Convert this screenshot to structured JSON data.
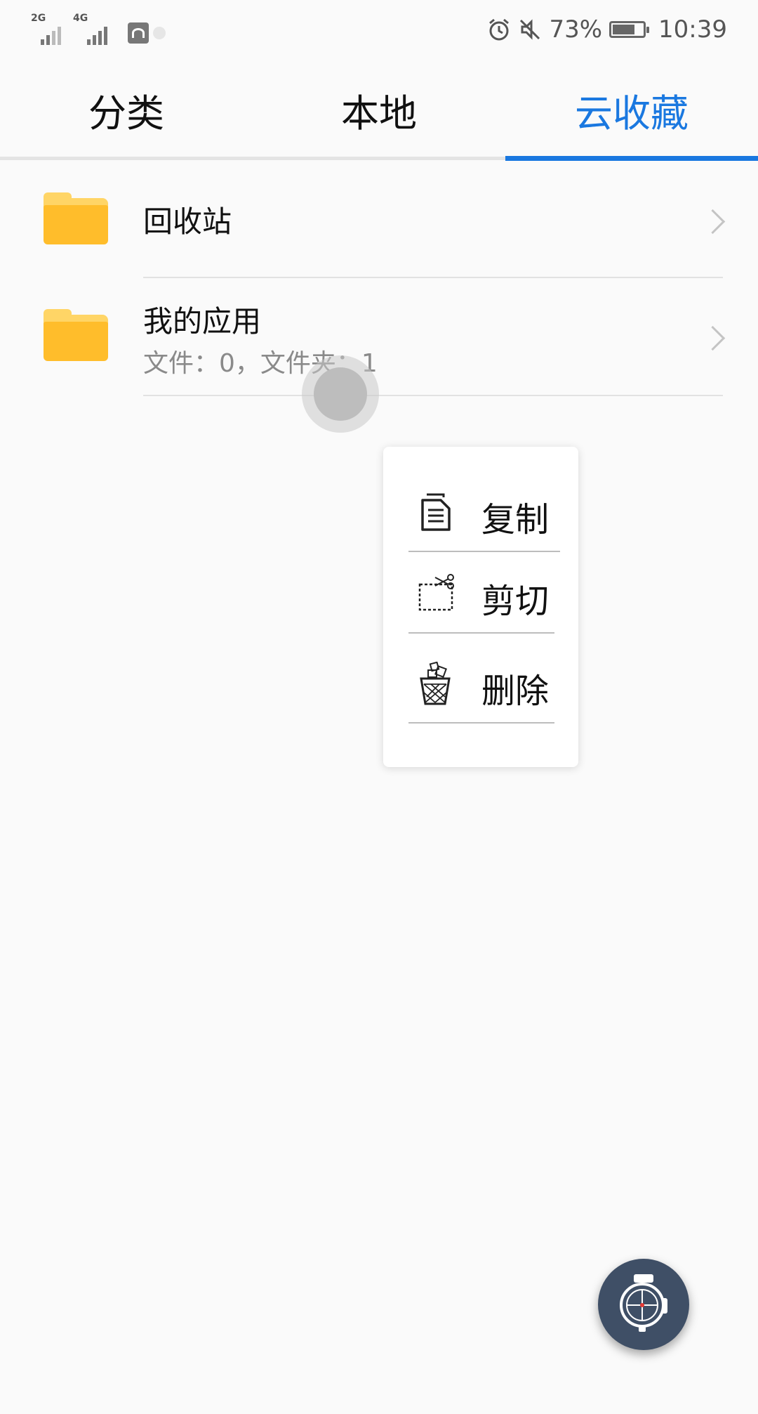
{
  "status_bar": {
    "signal1_label": "2G",
    "signal2_label": "4G",
    "battery_percent": "73%",
    "battery_level": 0.73,
    "time": "10:39",
    "icons": [
      "signal-2g-icon",
      "signal-4g-icon",
      "huawei-app-icon",
      "alarm-icon",
      "mute-icon",
      "battery-icon"
    ]
  },
  "tabs": [
    {
      "label": "分类",
      "active": false
    },
    {
      "label": "本地",
      "active": false
    },
    {
      "label": "云收藏",
      "active": true
    }
  ],
  "files": [
    {
      "name": "回收站",
      "subtitle": ""
    },
    {
      "name": "我的应用",
      "subtitle": "文件：0，文件夹：1"
    }
  ],
  "context_menu": {
    "items": [
      {
        "label": "复制",
        "icon": "copy-icon"
      },
      {
        "label": "剪切",
        "icon": "cut-icon"
      },
      {
        "label": "删除",
        "icon": "delete-icon"
      }
    ]
  },
  "colors": {
    "accent": "#1a78e0",
    "folder": "#ffbd2b",
    "fab": "#3f4f66"
  }
}
